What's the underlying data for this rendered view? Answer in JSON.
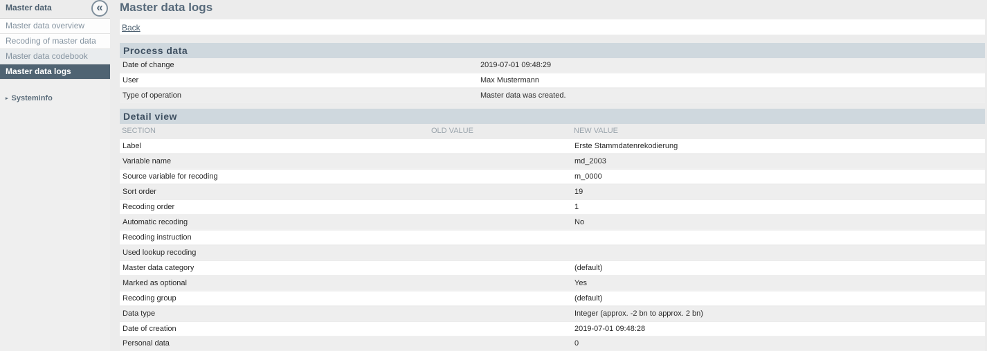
{
  "sidebar": {
    "title": "Master data",
    "collapse_icon": "«",
    "items": [
      {
        "label": "Master data overview"
      },
      {
        "label": "Recoding of master data"
      },
      {
        "label": "Master data codebook"
      },
      {
        "label": "Master data logs",
        "active": true
      }
    ],
    "systeminfo_label": "Systeminfo",
    "systeminfo_icon": "▸"
  },
  "main": {
    "title": "Master data logs",
    "back_label": "Back",
    "process": {
      "header": "Process data",
      "rows": [
        {
          "label": "Date of change",
          "value": "2019-07-01 09:48:29"
        },
        {
          "label": "User",
          "value": "Max Mustermann"
        },
        {
          "label": "Type of operation",
          "value": "Master data was created."
        }
      ]
    },
    "detail": {
      "header": "Detail view",
      "columns": [
        "SECTION",
        "OLD VALUE",
        "NEW VALUE"
      ],
      "rows": [
        {
          "section": "Label",
          "old": "",
          "new": "Erste Stammdatenrekodierung"
        },
        {
          "section": "Variable name",
          "old": "",
          "new": "md_2003"
        },
        {
          "section": "Source variable for recoding",
          "old": "",
          "new": "m_0000"
        },
        {
          "section": "Sort order",
          "old": "",
          "new": "19"
        },
        {
          "section": "Recoding order",
          "old": "",
          "new": "1"
        },
        {
          "section": "Automatic recoding",
          "old": "",
          "new": "No"
        },
        {
          "section": "Recoding instruction",
          "old": "",
          "new": ""
        },
        {
          "section": "Used lookup recoding",
          "old": "",
          "new": ""
        },
        {
          "section": "Master data category",
          "old": "",
          "new": "(default)"
        },
        {
          "section": "Marked as optional",
          "old": "",
          "new": "Yes"
        },
        {
          "section": "Recoding group",
          "old": "",
          "new": "(default)"
        },
        {
          "section": "Data type",
          "old": "",
          "new": "Integer (approx. -2 bn to approx. 2 bn)"
        },
        {
          "section": "Date of creation",
          "old": "",
          "new": "2019-07-01 09:48:28"
        },
        {
          "section": "Personal data",
          "old": "",
          "new": "0"
        }
      ]
    }
  }
}
